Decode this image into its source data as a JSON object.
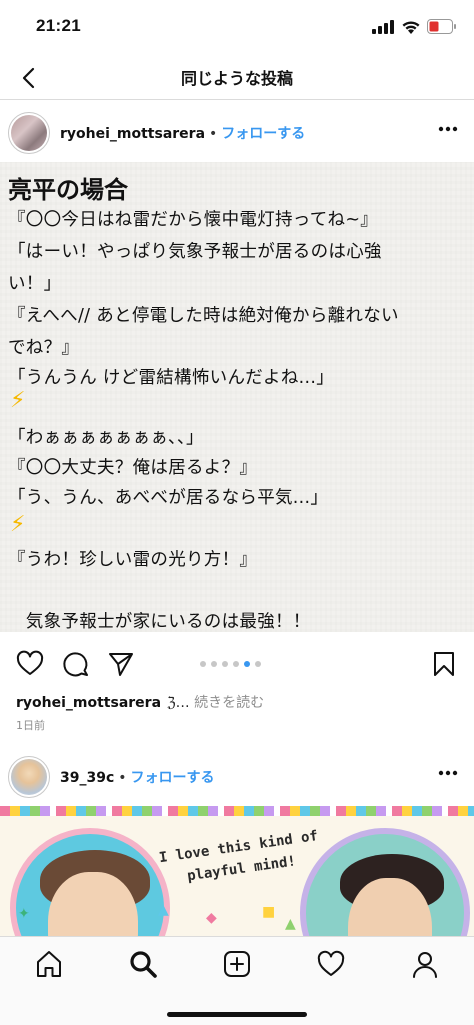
{
  "status_bar": {
    "time": "21:21"
  },
  "nav": {
    "title": "同じような投稿",
    "back_icon": "chevron-left-icon"
  },
  "post": {
    "username": "ryohei_mottsarera",
    "separator": "•",
    "follow_label": "フォローする",
    "image_text": {
      "title": "亮平の場合",
      "lines": [
        "『〇〇今日はね雷だから懐中電灯持ってね~』",
        "「はーい！やっぱり気象予報士が居るのは心強",
        "い！」",
        "『えへへ// あと停電した時は絶対俺から離れない",
        "でね？』",
        "「うんうん けど雷結構怖いんだよね...」",
        "「わぁぁぁぁぁぁぁ、、」",
        "『〇〇大丈夫？俺は居るよ？』",
        "「う、うん、あべべが居るなら平気...」",
        "『うわ！珍しい雷の光り方！』",
        "　気象予報士が家にいるのは最強！！"
      ],
      "bolt_emoji": "⚡"
    },
    "carousel": {
      "count": 6,
      "active_index": 4
    },
    "caption_trunc": "ℨ…",
    "caption_more": "続きを読む",
    "timestamp": "1日前"
  },
  "post2": {
    "username": "39_39c",
    "separator": "•",
    "follow_label": "フォローする",
    "image_text": {
      "tagline": "I love this kind of playful mind!"
    }
  },
  "tab_bar": {
    "items": [
      "home-icon",
      "search-icon",
      "new-post-icon",
      "heart-icon",
      "profile-icon"
    ],
    "active": "search-icon"
  },
  "colors": {
    "link_blue": "#3897f0",
    "text": "#111111",
    "muted": "#8e8e8e",
    "bolt": "#f5b800"
  }
}
